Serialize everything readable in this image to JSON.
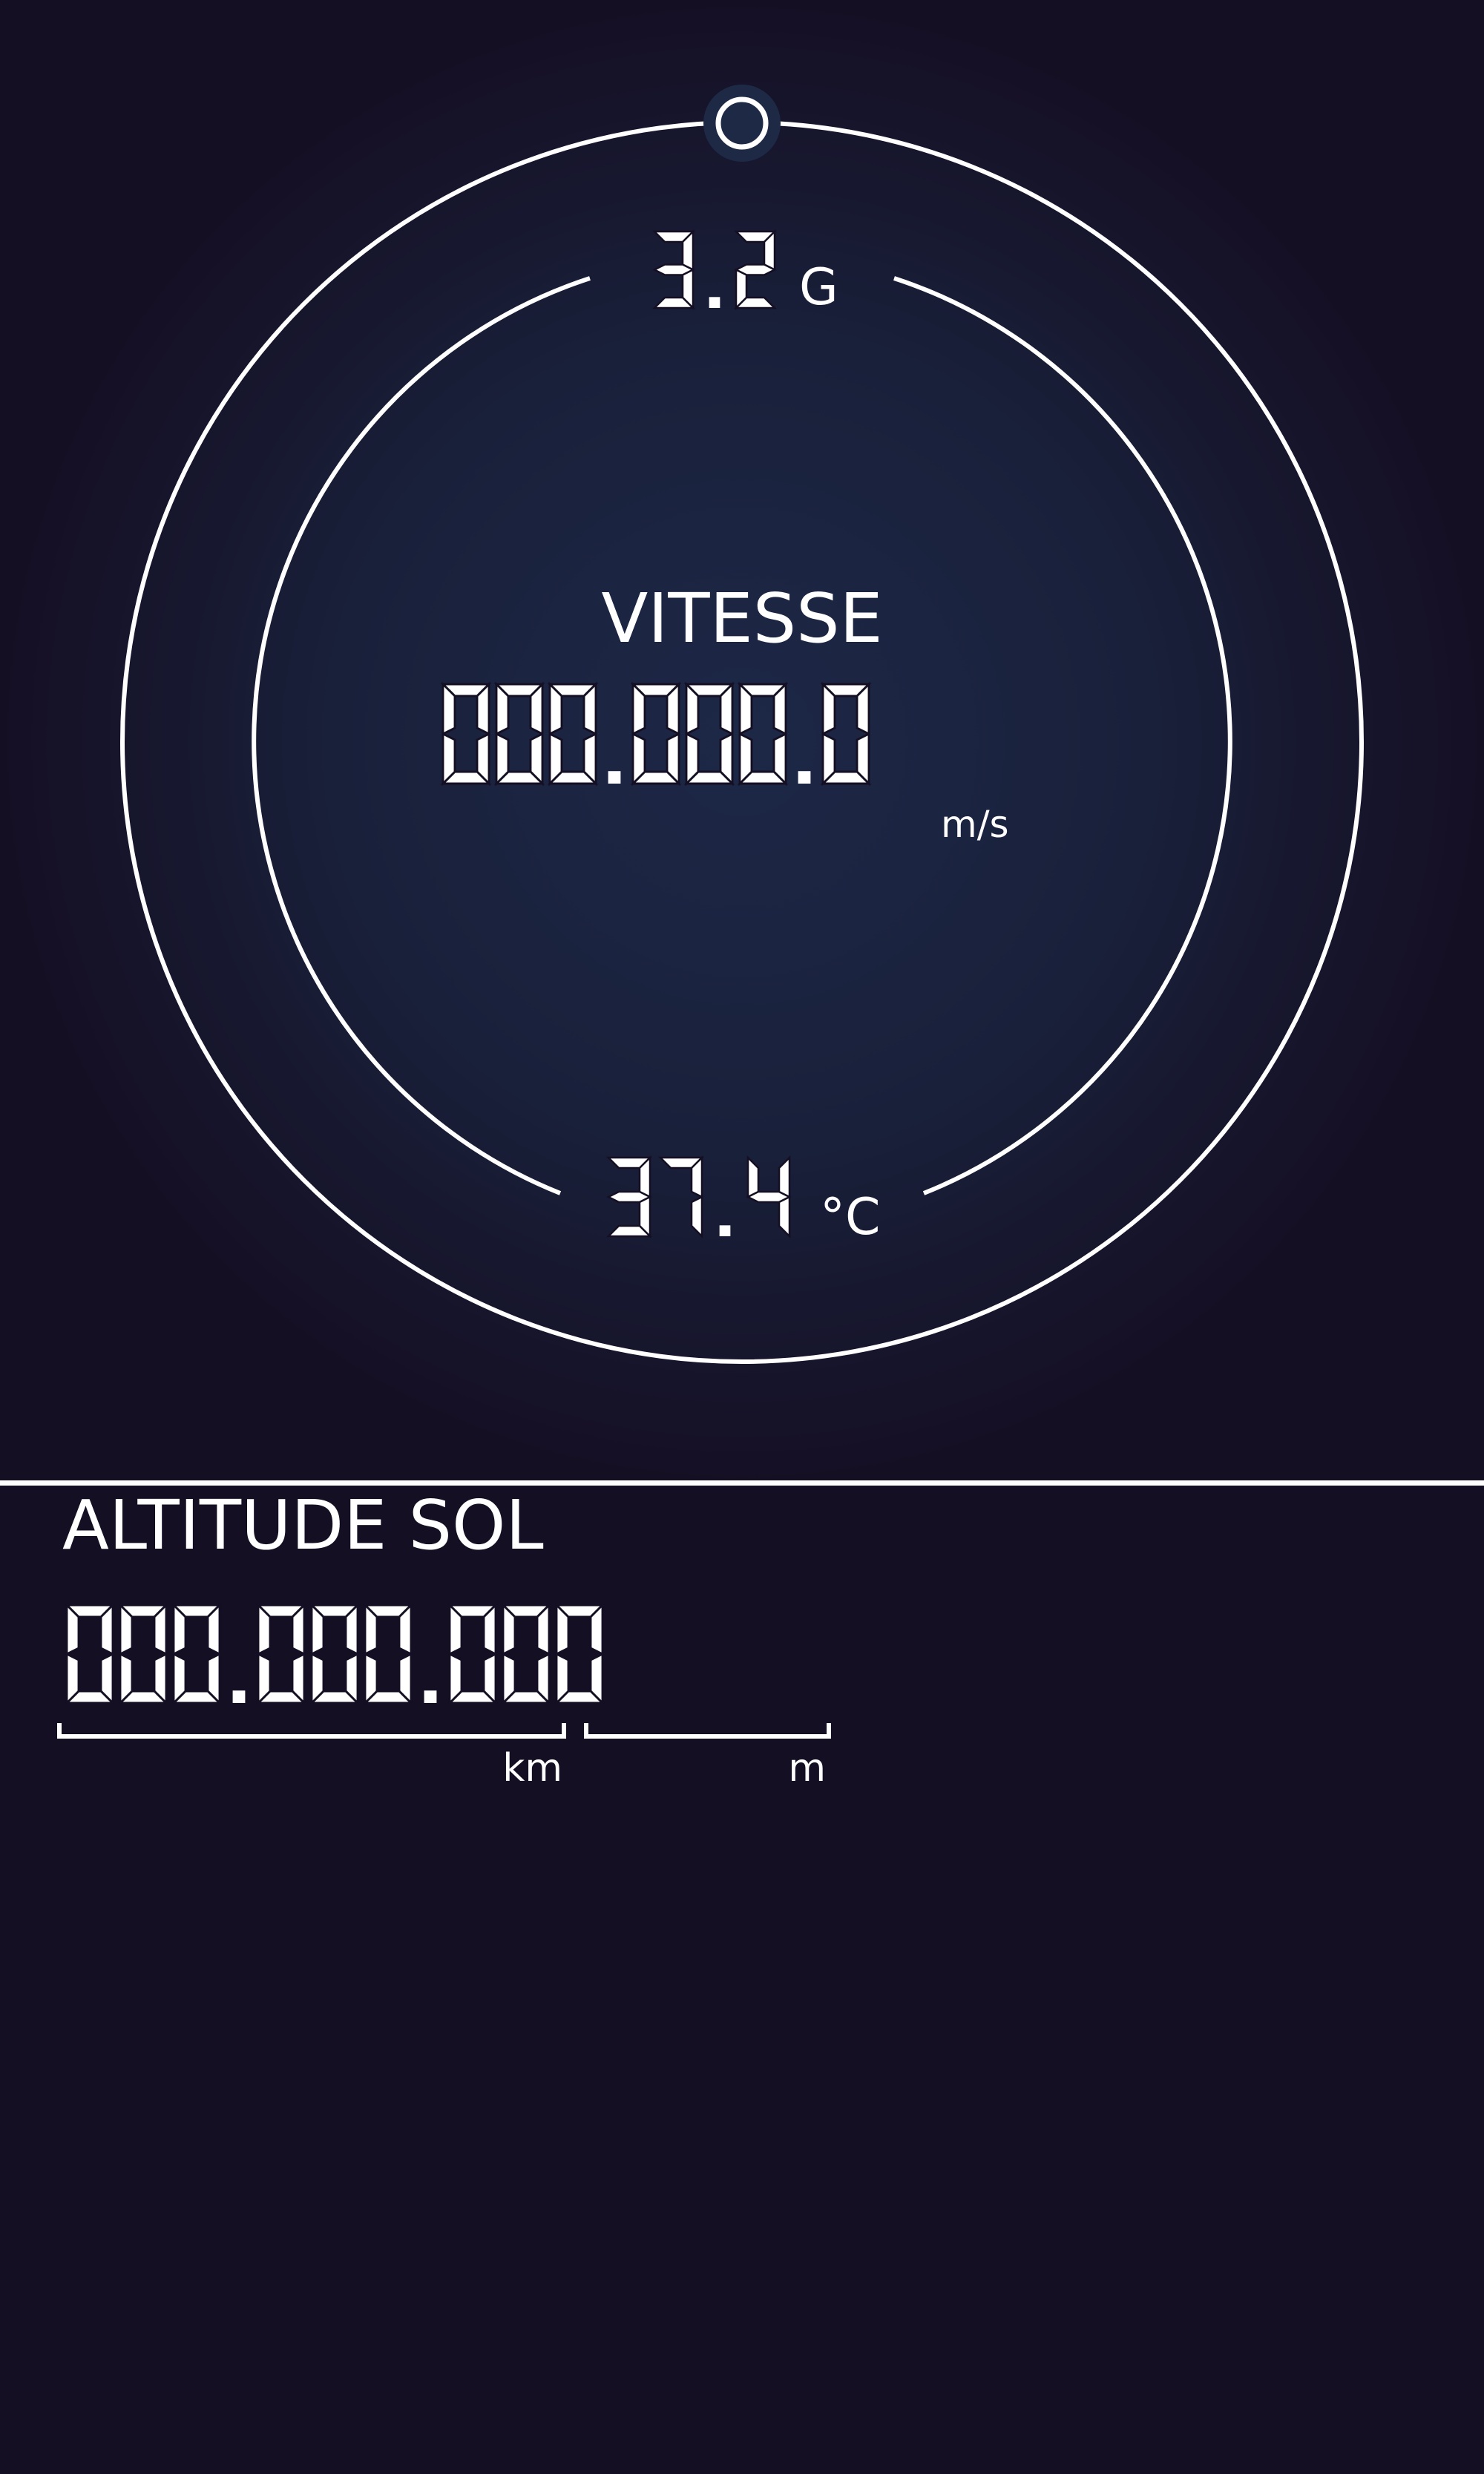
{
  "colors": {
    "background": "#150f24",
    "gauge_glow": "#1d2847",
    "foreground": "#ffffff",
    "knob_fill": "#1e2a45"
  },
  "gauge": {
    "knob_icon": "ring-knob-icon",
    "g_force": {
      "value": "3.2",
      "unit": "G"
    },
    "speed": {
      "label": "VITESSE",
      "value": "000.000.0",
      "unit": "m/s"
    },
    "temperature": {
      "value": "37.4",
      "unit": "°C"
    }
  },
  "altitude": {
    "label": "ALTITUDE SOL",
    "value": "000.000.000",
    "km_label": "km",
    "m_label": "m"
  }
}
